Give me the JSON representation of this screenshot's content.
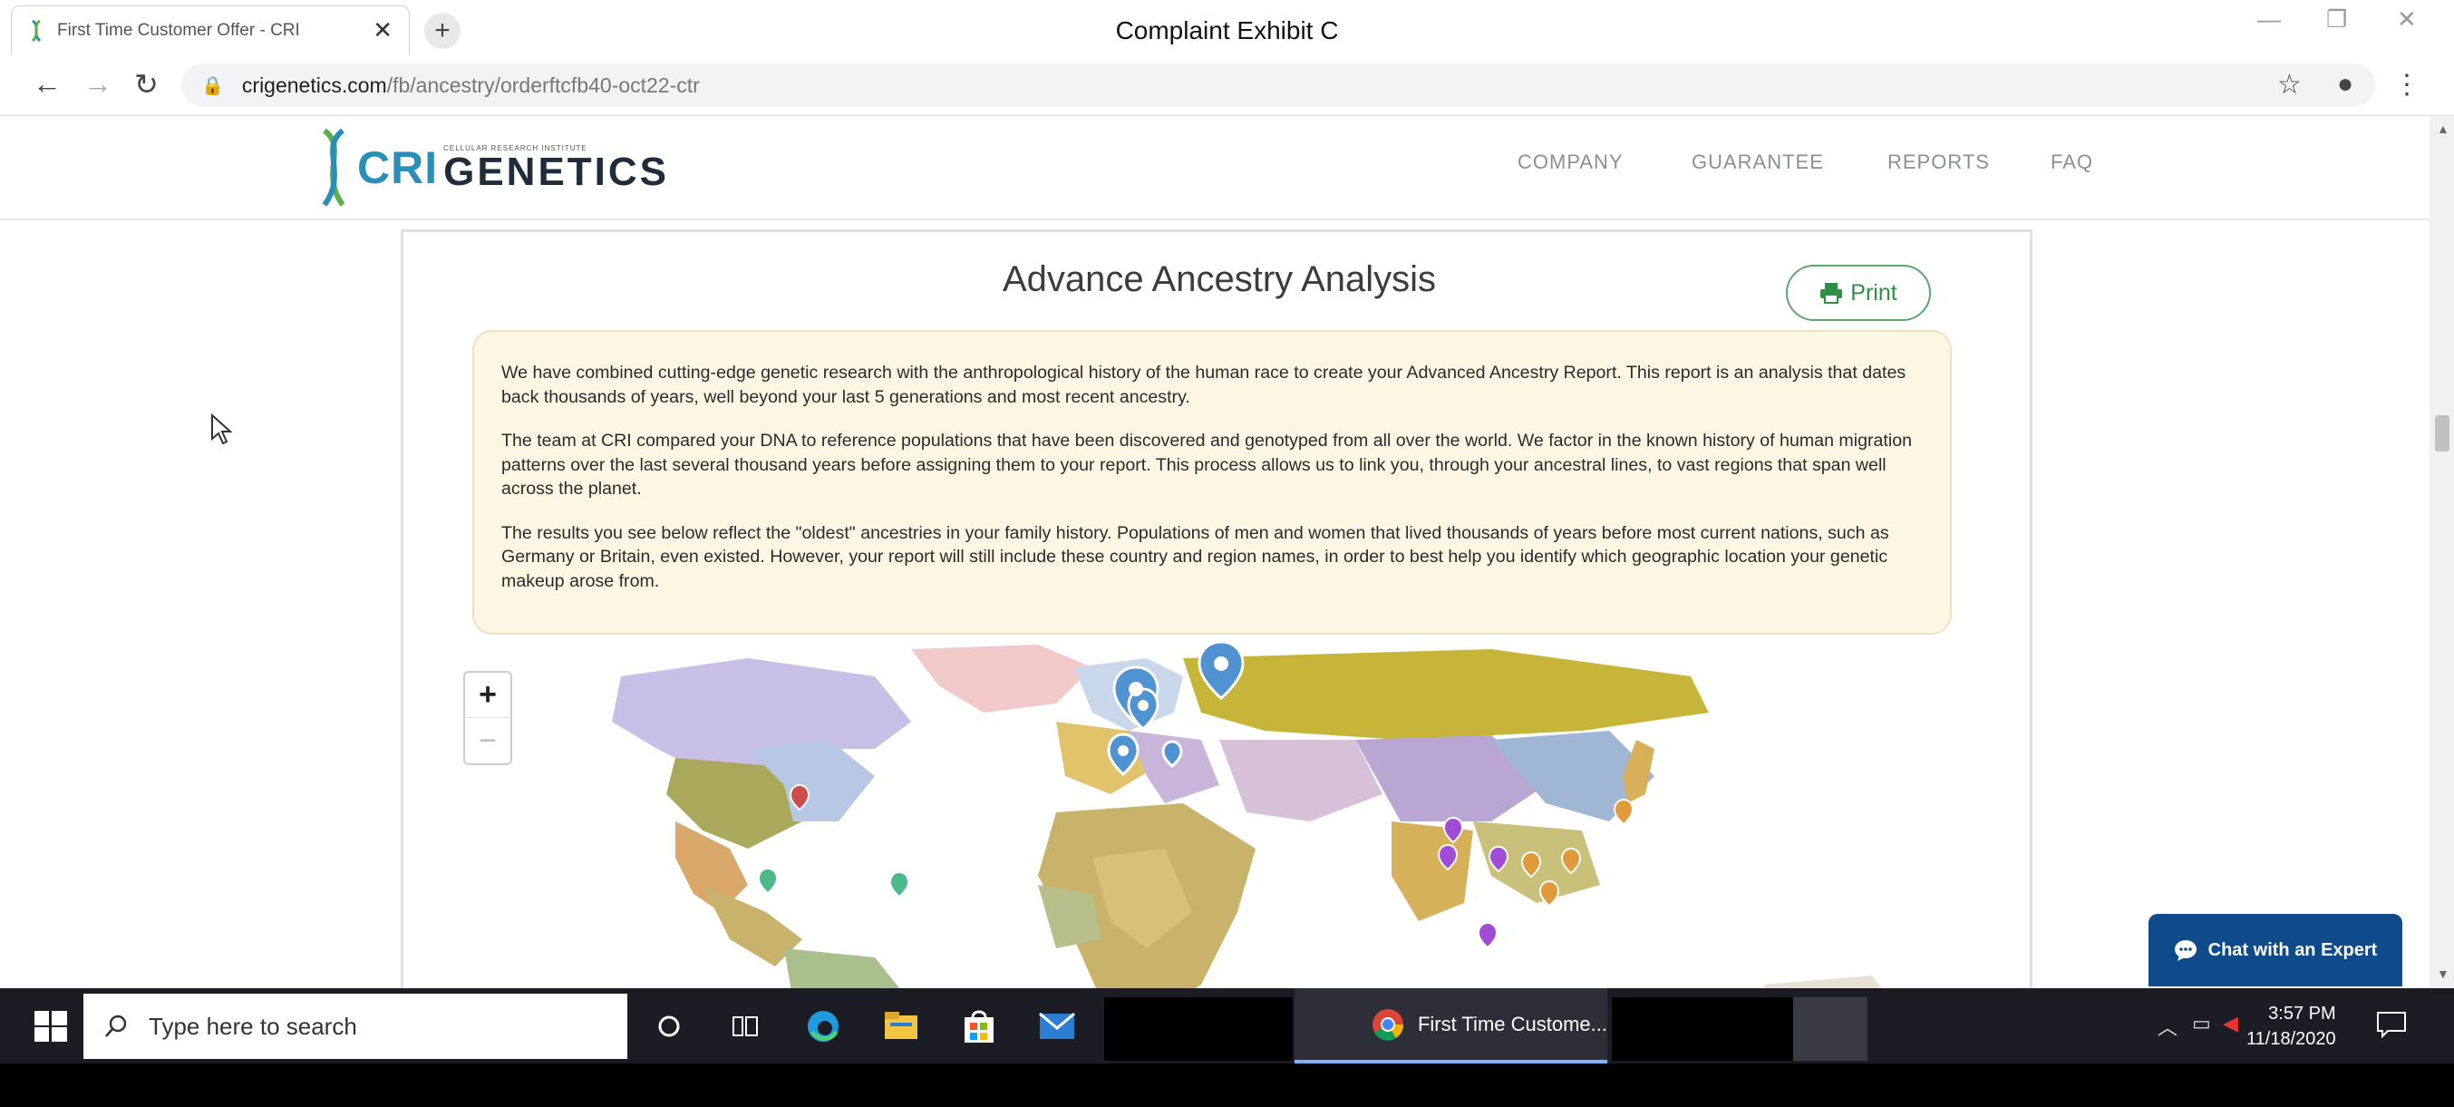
{
  "exhibit_label": "Complaint Exhibit C",
  "browser": {
    "tab_title": "First Time Customer Offer - CRI",
    "tab_close": "✕",
    "new_tab": "+",
    "url_host": "crigenetics.com",
    "url_path": "/fb/ancestry/orderftcfb40-oct22-ctr"
  },
  "site": {
    "logo_cri": "CRI",
    "logo_tagline": "CELLULAR RESEARCH INSTITUTE",
    "logo_genetics": "GENETICS",
    "nav": [
      "COMPANY",
      "GUARANTEE",
      "REPORTS",
      "FAQ"
    ]
  },
  "report": {
    "heading": "Advance Ancestry Analysis",
    "print_label": "Print",
    "paragraphs": [
      "We have combined cutting-edge genetic research with the anthropological history of the human race to create your Advanced Ancestry Report. This report is an analysis that dates back thousands of years, well beyond your last 5 generations and most recent ancestry.",
      "The team at CRI compared your DNA to reference populations that have been discovered and genotyped from all over the world. We factor in the known history of human migration patterns over the last several thousand years before assigning them to your report. This process allows us to link you, through your ancestral lines, to vast regions that span well across the planet.",
      "The results you see below reflect the \"oldest\" ancestries in your family history. Populations of men and women that lived thousands of years before most current nations, such as Germany or Britain, even existed. However, your report will still include these country and region names, in order to best help you identify which geographic location your genetic makeup arose from."
    ],
    "zoom_in": "+",
    "zoom_out": "−"
  },
  "chat": {
    "label": "Chat with an Expert"
  },
  "taskbar": {
    "search_placeholder": "Type here to search",
    "chrome_task_label": "First Time Custome...",
    "time": "3:57 PM",
    "date": "11/18/2020"
  },
  "colors": {
    "brand_blue": "#2a8fb8",
    "print_green": "#2f8f45",
    "intro_bg": "#fdf6e2",
    "chat_bg": "#0f4a8a"
  }
}
